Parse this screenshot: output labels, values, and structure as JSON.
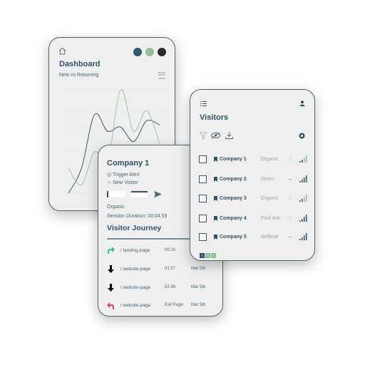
{
  "dashboard": {
    "title": "Dashboard",
    "subtitle": "New vs Returning",
    "dot_colors": [
      "#2f5a6b",
      "#8fbf94",
      "#2a2a2a"
    ]
  },
  "chart_data": {
    "type": "line",
    "title": "",
    "xlabel": "",
    "ylabel": "",
    "ylim": [
      0,
      5
    ],
    "grid": true,
    "x": [
      1,
      2,
      3,
      4,
      5,
      6,
      7,
      8
    ],
    "series": [
      {
        "color": "#3d5868",
        "values": [
          0,
          1.2,
          3.8,
          3.0,
          3.2,
          2.5,
          3.5,
          3.3
        ]
      },
      {
        "color": "#9cc8a0",
        "values": [
          1.2,
          0.4,
          2.0,
          1.5,
          5.0,
          3.0,
          4.0,
          2.4
        ]
      }
    ]
  },
  "company": {
    "title": "Company 1",
    "trigger": "Trigger Alert",
    "new_visitor": "New Visitor",
    "source": "Organic",
    "session": "Session Duration: 00:04.59",
    "journey_title": "Visitor Journey",
    "journey": [
      {
        "icon": "arrow-forward-icon",
        "color": "#2ecc71",
        "page": "/ landing-page",
        "time": "00:24",
        "date": ""
      },
      {
        "icon": "arrow-down-icon",
        "color": "#000000",
        "page": "/ website-page",
        "time": "01:57",
        "date": "Mar 5th"
      },
      {
        "icon": "arrow-down-icon",
        "color": "#000000",
        "page": "/ website-page",
        "time": "02:48",
        "date": "Mar 5th"
      },
      {
        "icon": "arrow-back-icon",
        "color": "#e8405a",
        "page": "/ website-page",
        "time": "Exit Page",
        "date": "Mar 5th"
      }
    ]
  },
  "visitors": {
    "title": "Visitors",
    "rows": [
      {
        "name": "Company 1",
        "source": "Organic",
        "icon": "star",
        "signal_color": "#8fbf94"
      },
      {
        "name": "Company 2",
        "source": "Direct",
        "icon": "arrow",
        "signal_color": "#2f5366"
      },
      {
        "name": "Company 3",
        "source": "Organic",
        "icon": "star",
        "signal_color": "#8fbf94"
      },
      {
        "name": "Company 4",
        "source": "Paid Ads",
        "icon": "star",
        "signal_color": "#2f5366"
      },
      {
        "name": "Company 5",
        "source": "Refferal",
        "icon": "arrow",
        "signal_color": "#2f5366"
      }
    ],
    "pages": [
      "1",
      "2",
      ">"
    ]
  }
}
